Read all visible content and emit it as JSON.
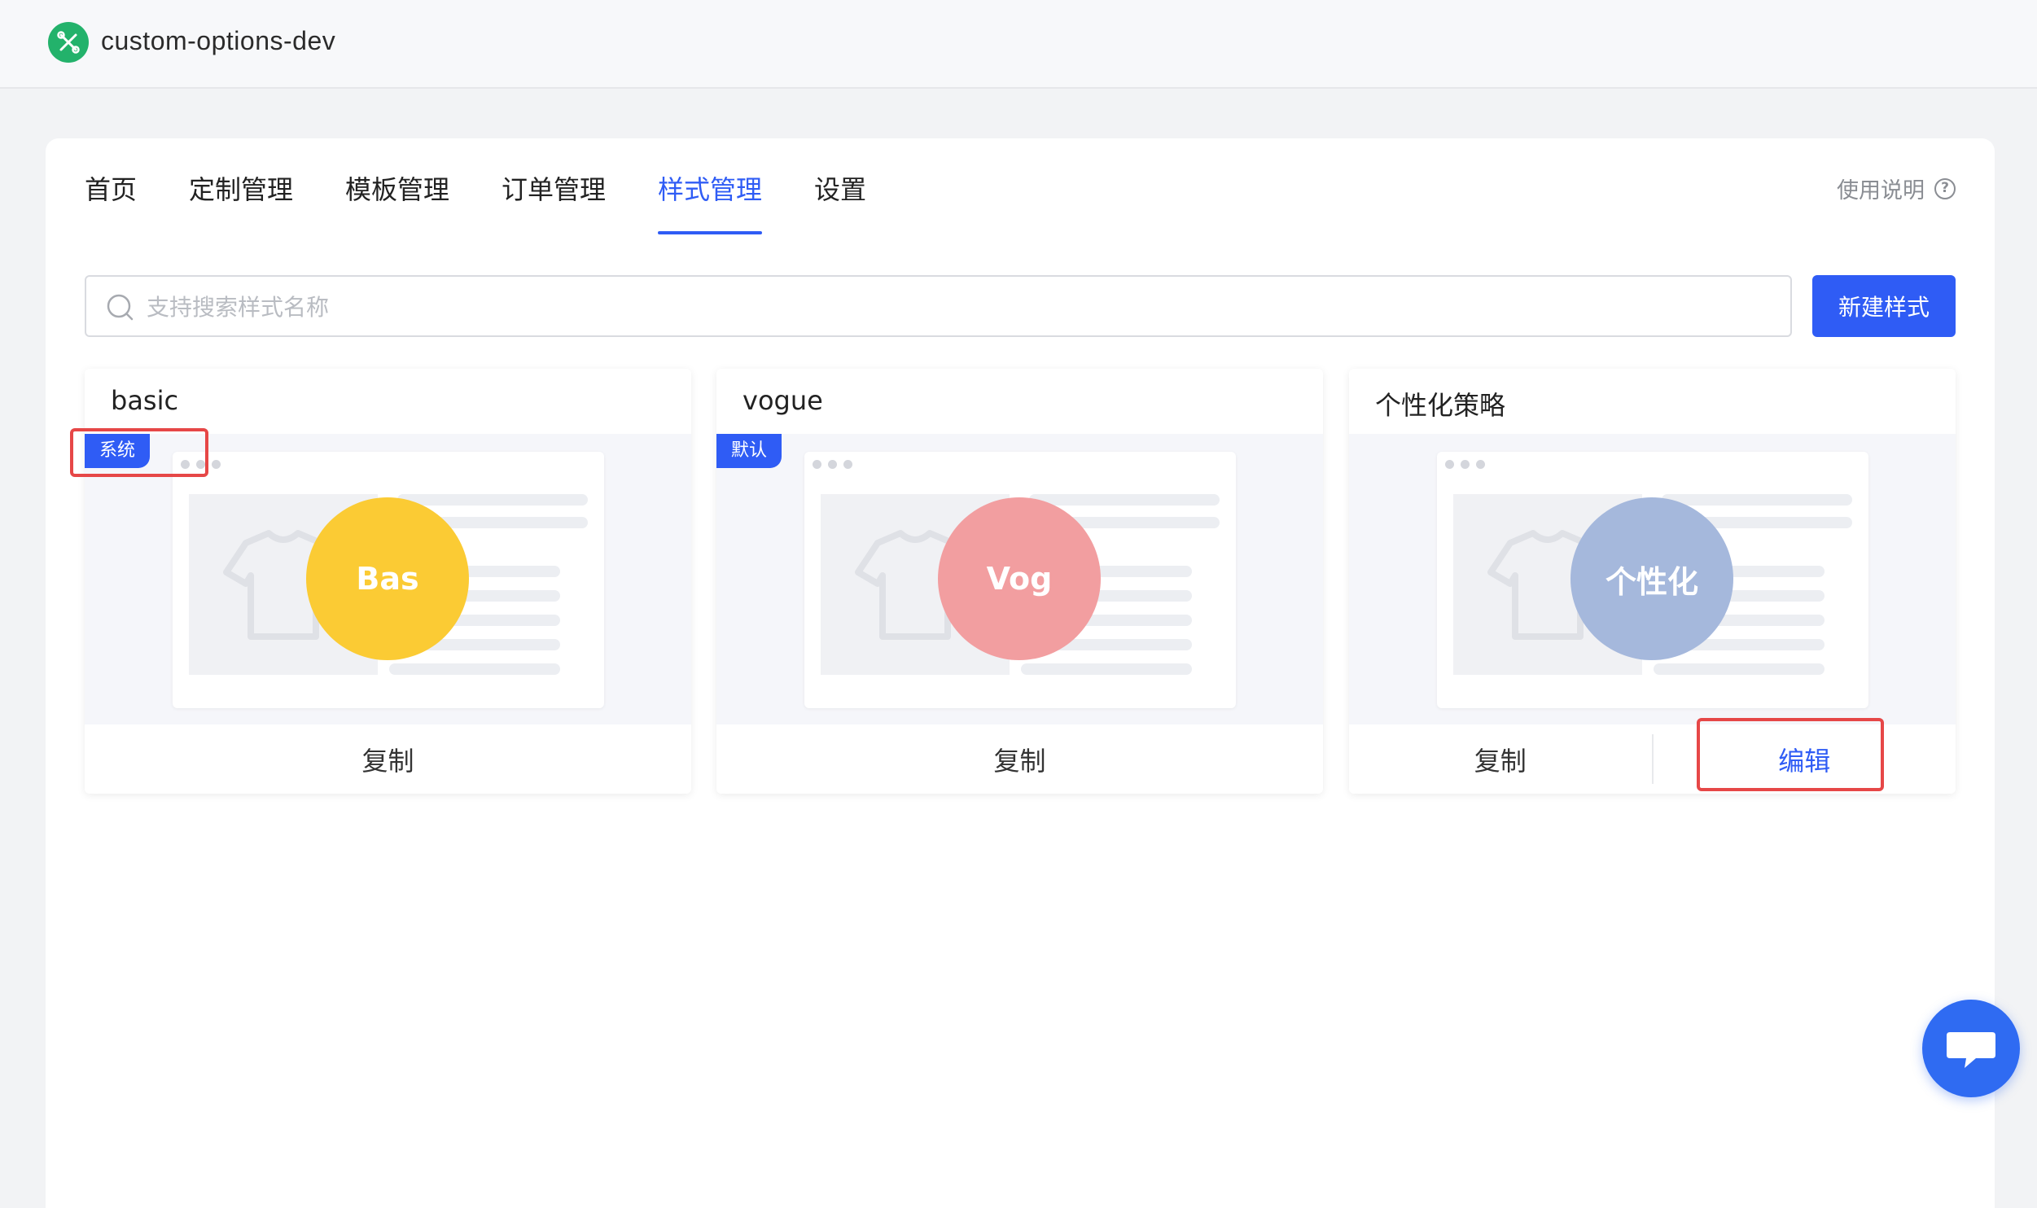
{
  "app": {
    "title": "custom-options-dev",
    "logo_icon": "tools-icon",
    "brand_color": "#23b26b"
  },
  "nav": {
    "tabs": [
      {
        "label": "首页"
      },
      {
        "label": "定制管理"
      },
      {
        "label": "模板管理"
      },
      {
        "label": "订单管理"
      },
      {
        "label": "样式管理",
        "active": true
      },
      {
        "label": "设置"
      }
    ],
    "help_label": "使用说明",
    "help_icon": "question-circle-icon",
    "accent_color": "#2f5cf5"
  },
  "search": {
    "placeholder": "支持搜索样式名称",
    "value": ""
  },
  "new_button_label": "新建样式",
  "cards": [
    {
      "title": "basic",
      "badge": "系统",
      "circle_text": "Bas",
      "circle_color": "#fbcb34",
      "copy_label": "复制"
    },
    {
      "title": "vogue",
      "badge": "默认",
      "circle_text": "Vog",
      "circle_color": "#f29ea0",
      "copy_label": "复制"
    },
    {
      "title": "个性化策略",
      "circle_text": "个性化",
      "circle_color": "#a5b8dc",
      "copy_label": "复制",
      "edit_label": "编辑"
    }
  ],
  "chat_icon": "chat-bubble-icon",
  "highlight_color": "#e64747"
}
